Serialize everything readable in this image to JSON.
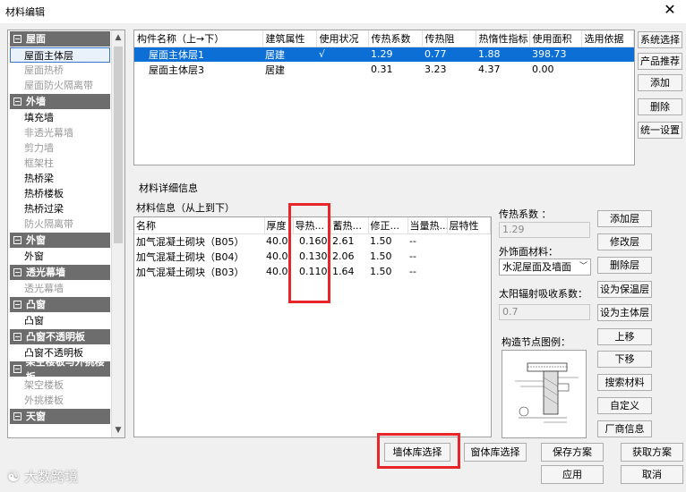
{
  "window": {
    "title": "材料编辑",
    "close_glyph": "✕"
  },
  "sidebar": {
    "groups": [
      {
        "label": "屋面",
        "toggle": "−",
        "items": [
          {
            "label": "屋面主体层",
            "selected": true
          },
          {
            "label": "屋面热桥",
            "dim": true
          },
          {
            "label": "屋面防火隔离带",
            "dim": true
          }
        ]
      },
      {
        "label": "外墙",
        "toggle": "−",
        "items": [
          {
            "label": "填充墙"
          },
          {
            "label": "非透光幕墙",
            "dim": true
          },
          {
            "label": "剪力墙",
            "dim": true
          },
          {
            "label": "框架柱",
            "dim": true
          },
          {
            "label": "热桥梁"
          },
          {
            "label": "热桥楼板"
          },
          {
            "label": "热桥过梁"
          },
          {
            "label": "防火隔离带",
            "dim": true
          }
        ]
      },
      {
        "label": "外窗",
        "toggle": "−",
        "items": [
          {
            "label": "外窗"
          }
        ]
      },
      {
        "label": "透光幕墙",
        "toggle": "−",
        "items": [
          {
            "label": "透光幕墙",
            "dim": true
          }
        ]
      },
      {
        "label": "凸窗",
        "toggle": "−",
        "items": [
          {
            "label": "凸窗"
          }
        ]
      },
      {
        "label": "凸窗不透明板",
        "toggle": "−",
        "items": [
          {
            "label": "凸窗不透明板"
          }
        ]
      },
      {
        "label": "架空楼板与外挑楼板",
        "toggle": "−",
        "items": [
          {
            "label": "架空楼板",
            "dim": true
          },
          {
            "label": "外挑楼板",
            "dim": true
          }
        ]
      },
      {
        "label": "天窗",
        "toggle": "−",
        "items": []
      }
    ]
  },
  "component_table": {
    "headers": [
      "构件名称（上→下）",
      "建筑属性",
      "使用状况",
      "传热系数",
      "传热阻",
      "热惰性指标",
      "使用面积",
      "选用依据"
    ],
    "rows": [
      [
        "屋面主体层1",
        "居建",
        "√",
        "1.29",
        "0.77",
        "1.88",
        "398.73",
        ""
      ],
      [
        "屋面主体层3",
        "居建",
        "",
        "0.31",
        "3.23",
        "4.37",
        "0.00",
        ""
      ]
    ]
  },
  "right_buttons": [
    "系统选择",
    "产品推荐",
    "添加",
    "删除",
    "统一设置"
  ],
  "material_section": {
    "title": "材料详细信息",
    "subtitle": "材料信息（从上到下）",
    "headers": [
      "名称",
      "厚度",
      "导热...",
      "蓄热...",
      "修正...",
      "当量热...",
      "层特性"
    ],
    "rows": [
      [
        "加气混凝土砌块（B05）",
        "40.0",
        "0.160",
        "2.61",
        "1.50",
        "--",
        ""
      ],
      [
        "加气混凝土砌块（B04）",
        "40.0",
        "0.130",
        "2.06",
        "1.50",
        "--",
        ""
      ],
      [
        "加气混凝土砌块（B03）",
        "40.0",
        "0.110",
        "1.64",
        "1.50",
        "--",
        ""
      ]
    ]
  },
  "props": {
    "u_label": "传热系数 ：",
    "u_value": "1.29",
    "finish_label": "外饰面材料：",
    "finish_value": "水泥屋面及墙面",
    "solar_label": "太阳辐射吸收系数：",
    "solar_value": "0.7",
    "detail_label": "构造节点图例："
  },
  "layer_buttons": [
    "添加层",
    "修改层",
    "删除层",
    "设为保温层",
    "设为主体层",
    "上移",
    "下移",
    "搜索材料",
    "自定义",
    "厂商信息"
  ],
  "bottom_buttons": {
    "wall_lib": "墙体库选择",
    "window_lib": "窗体库选择",
    "save": "保存方案",
    "fetch": "获取方案",
    "apply": "应用",
    "cancel": "取消"
  },
  "watermark": "大数跨境"
}
